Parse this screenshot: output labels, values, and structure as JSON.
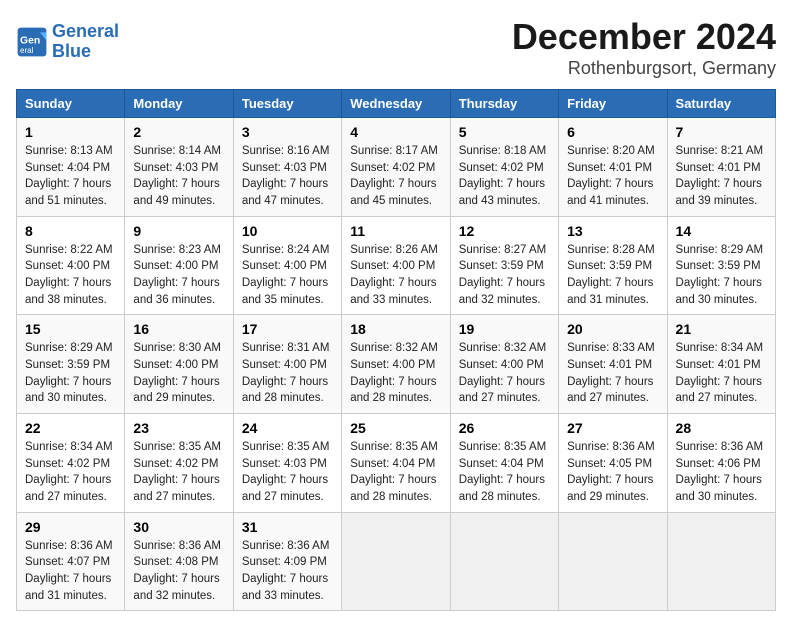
{
  "header": {
    "logo_line1": "General",
    "logo_line2": "Blue",
    "title": "December 2024",
    "subtitle": "Rothenburgsort, Germany"
  },
  "days_of_week": [
    "Sunday",
    "Monday",
    "Tuesday",
    "Wednesday",
    "Thursday",
    "Friday",
    "Saturday"
  ],
  "weeks": [
    [
      {
        "day": "1",
        "detail": "Sunrise: 8:13 AM\nSunset: 4:04 PM\nDaylight: 7 hours\nand 51 minutes."
      },
      {
        "day": "2",
        "detail": "Sunrise: 8:14 AM\nSunset: 4:03 PM\nDaylight: 7 hours\nand 49 minutes."
      },
      {
        "day": "3",
        "detail": "Sunrise: 8:16 AM\nSunset: 4:03 PM\nDaylight: 7 hours\nand 47 minutes."
      },
      {
        "day": "4",
        "detail": "Sunrise: 8:17 AM\nSunset: 4:02 PM\nDaylight: 7 hours\nand 45 minutes."
      },
      {
        "day": "5",
        "detail": "Sunrise: 8:18 AM\nSunset: 4:02 PM\nDaylight: 7 hours\nand 43 minutes."
      },
      {
        "day": "6",
        "detail": "Sunrise: 8:20 AM\nSunset: 4:01 PM\nDaylight: 7 hours\nand 41 minutes."
      },
      {
        "day": "7",
        "detail": "Sunrise: 8:21 AM\nSunset: 4:01 PM\nDaylight: 7 hours\nand 39 minutes."
      }
    ],
    [
      {
        "day": "8",
        "detail": "Sunrise: 8:22 AM\nSunset: 4:00 PM\nDaylight: 7 hours\nand 38 minutes."
      },
      {
        "day": "9",
        "detail": "Sunrise: 8:23 AM\nSunset: 4:00 PM\nDaylight: 7 hours\nand 36 minutes."
      },
      {
        "day": "10",
        "detail": "Sunrise: 8:24 AM\nSunset: 4:00 PM\nDaylight: 7 hours\nand 35 minutes."
      },
      {
        "day": "11",
        "detail": "Sunrise: 8:26 AM\nSunset: 4:00 PM\nDaylight: 7 hours\nand 33 minutes."
      },
      {
        "day": "12",
        "detail": "Sunrise: 8:27 AM\nSunset: 3:59 PM\nDaylight: 7 hours\nand 32 minutes."
      },
      {
        "day": "13",
        "detail": "Sunrise: 8:28 AM\nSunset: 3:59 PM\nDaylight: 7 hours\nand 31 minutes."
      },
      {
        "day": "14",
        "detail": "Sunrise: 8:29 AM\nSunset: 3:59 PM\nDaylight: 7 hours\nand 30 minutes."
      }
    ],
    [
      {
        "day": "15",
        "detail": "Sunrise: 8:29 AM\nSunset: 3:59 PM\nDaylight: 7 hours\nand 30 minutes."
      },
      {
        "day": "16",
        "detail": "Sunrise: 8:30 AM\nSunset: 4:00 PM\nDaylight: 7 hours\nand 29 minutes."
      },
      {
        "day": "17",
        "detail": "Sunrise: 8:31 AM\nSunset: 4:00 PM\nDaylight: 7 hours\nand 28 minutes."
      },
      {
        "day": "18",
        "detail": "Sunrise: 8:32 AM\nSunset: 4:00 PM\nDaylight: 7 hours\nand 28 minutes."
      },
      {
        "day": "19",
        "detail": "Sunrise: 8:32 AM\nSunset: 4:00 PM\nDaylight: 7 hours\nand 27 minutes."
      },
      {
        "day": "20",
        "detail": "Sunrise: 8:33 AM\nSunset: 4:01 PM\nDaylight: 7 hours\nand 27 minutes."
      },
      {
        "day": "21",
        "detail": "Sunrise: 8:34 AM\nSunset: 4:01 PM\nDaylight: 7 hours\nand 27 minutes."
      }
    ],
    [
      {
        "day": "22",
        "detail": "Sunrise: 8:34 AM\nSunset: 4:02 PM\nDaylight: 7 hours\nand 27 minutes."
      },
      {
        "day": "23",
        "detail": "Sunrise: 8:35 AM\nSunset: 4:02 PM\nDaylight: 7 hours\nand 27 minutes."
      },
      {
        "day": "24",
        "detail": "Sunrise: 8:35 AM\nSunset: 4:03 PM\nDaylight: 7 hours\nand 27 minutes."
      },
      {
        "day": "25",
        "detail": "Sunrise: 8:35 AM\nSunset: 4:04 PM\nDaylight: 7 hours\nand 28 minutes."
      },
      {
        "day": "26",
        "detail": "Sunrise: 8:35 AM\nSunset: 4:04 PM\nDaylight: 7 hours\nand 28 minutes."
      },
      {
        "day": "27",
        "detail": "Sunrise: 8:36 AM\nSunset: 4:05 PM\nDaylight: 7 hours\nand 29 minutes."
      },
      {
        "day": "28",
        "detail": "Sunrise: 8:36 AM\nSunset: 4:06 PM\nDaylight: 7 hours\nand 30 minutes."
      }
    ],
    [
      {
        "day": "29",
        "detail": "Sunrise: 8:36 AM\nSunset: 4:07 PM\nDaylight: 7 hours\nand 31 minutes."
      },
      {
        "day": "30",
        "detail": "Sunrise: 8:36 AM\nSunset: 4:08 PM\nDaylight: 7 hours\nand 32 minutes."
      },
      {
        "day": "31",
        "detail": "Sunrise: 8:36 AM\nSunset: 4:09 PM\nDaylight: 7 hours\nand 33 minutes."
      },
      null,
      null,
      null,
      null
    ]
  ]
}
